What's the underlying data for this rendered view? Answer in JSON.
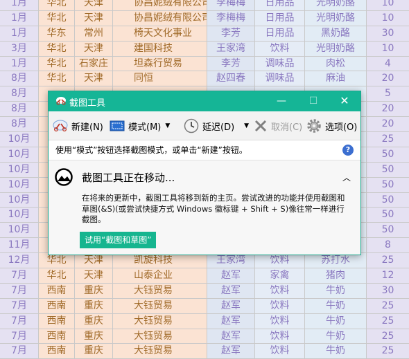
{
  "sheet": {
    "rows": [
      [
        "1月",
        "华北",
        "天津",
        "协昌妮绒有限公司",
        "李梅梅",
        "日用品",
        "光明奶酪",
        "10"
      ],
      [
        "1月",
        "华北",
        "天津",
        "协昌妮绒有限公司",
        "李梅梅",
        "日用品",
        "光明奶酪",
        "10"
      ],
      [
        "1月",
        "华东",
        "常州",
        "椅天文化事业",
        "李芳",
        "日用品",
        "黑奶酪",
        "30"
      ],
      [
        "3月",
        "华北",
        "天津",
        "建国科技",
        "王家湾",
        "饮料",
        "光明奶酪",
        "10"
      ],
      [
        "1月",
        "华北",
        "石家庄",
        "坦森行贸易",
        "李芳",
        "调味品",
        "肉松",
        "4"
      ],
      [
        "8月",
        "华北",
        "天津",
        "同恒",
        "赵四春",
        "调味品",
        "麻油",
        "20"
      ],
      [
        "8月",
        "",
        "",
        "",
        "",
        "",
        "",
        "5"
      ],
      [
        "8月",
        "",
        "",
        "",
        "",
        "",
        "",
        "20"
      ],
      [
        "8月",
        "",
        "",
        "",
        "",
        "",
        "",
        "20"
      ],
      [
        "10月",
        "",
        "",
        "",
        "",
        "",
        "",
        "25"
      ],
      [
        "10月",
        "",
        "",
        "",
        "",
        "",
        "",
        "50"
      ],
      [
        "10月",
        "",
        "",
        "",
        "",
        "",
        "",
        "50"
      ],
      [
        "10月",
        "",
        "",
        "",
        "",
        "",
        "",
        "50"
      ],
      [
        "10月",
        "",
        "",
        "",
        "",
        "",
        "",
        "50"
      ],
      [
        "10月",
        "",
        "",
        "",
        "",
        "",
        "",
        "50"
      ],
      [
        "10月",
        "",
        "",
        "",
        "",
        "",
        "",
        "50"
      ],
      [
        "11月",
        "",
        "",
        "",
        "",
        "",
        "",
        "8"
      ],
      [
        "12月",
        "华北",
        "天津",
        "凯旋科技",
        "王家湾",
        "饮料",
        "苏打水",
        "25"
      ],
      [
        "7月",
        "华北",
        "天津",
        "山泰企业",
        "赵军",
        "家禽",
        "猪肉",
        "12"
      ],
      [
        "7月",
        "西南",
        "重庆",
        "大钰贸易",
        "赵军",
        "饮料",
        "牛奶",
        "30"
      ],
      [
        "7月",
        "西南",
        "重庆",
        "大钰贸易",
        "赵军",
        "饮料",
        "牛奶",
        "25"
      ],
      [
        "7月",
        "西南",
        "重庆",
        "大钰贸易",
        "赵军",
        "饮料",
        "牛奶",
        "25"
      ],
      [
        "7月",
        "西南",
        "重庆",
        "大钰贸易",
        "赵军",
        "饮料",
        "牛奶",
        "25"
      ],
      [
        "7月",
        "西南",
        "重庆",
        "大钰贸易",
        "赵军",
        "饮料",
        "牛奶",
        "25"
      ]
    ]
  },
  "window": {
    "title": "截图工具",
    "toolbar": {
      "new_label": "新建(N)",
      "mode_label": "模式(M)",
      "delay_label": "延迟(D)",
      "cancel_label": "取消(C)",
      "options_label": "选项(O)"
    },
    "hint": "使用“模式”按钮选择截图模式，或单击“新建”按钮。",
    "notice": {
      "title": "截图工具正在移动...",
      "body": "在将来的更新中，截图工具将移到新的主页。尝试改进的功能并使用截图和草图(&S)(或尝试快捷方式 Windows 徽标键 + Shift + S)像往常一样进行截图。",
      "button": "试用“截图和草图”"
    }
  },
  "icons": {
    "app": "scissors-icon",
    "new": "scissors-icon",
    "mode": "rectangle-snip-icon",
    "delay": "clock-icon",
    "cancel": "x-icon",
    "options": "gear-icon",
    "help": "help-icon",
    "notice": "snip-sketch-icon",
    "collapse": "chevron-up-icon"
  }
}
